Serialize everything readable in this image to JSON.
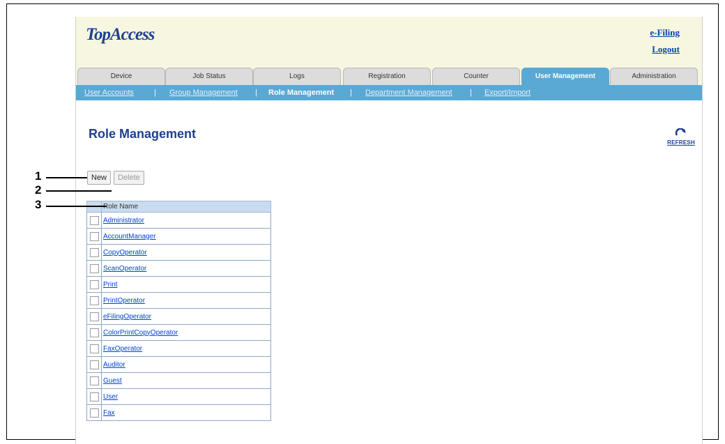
{
  "header": {
    "logo": "TopAccess",
    "links": {
      "efiling": "e-Filing",
      "logout": "Logout"
    }
  },
  "tabs": [
    {
      "label": "Device"
    },
    {
      "label": "Job Status"
    },
    {
      "label": "Logs"
    },
    {
      "label": "Registration"
    },
    {
      "label": "Counter"
    },
    {
      "label": "User Management",
      "active": true
    },
    {
      "label": "Administration"
    }
  ],
  "subnav": {
    "items": [
      "User Accounts",
      "Group Management",
      "Role Management",
      "Department Management",
      "Export/Import"
    ],
    "separator": "|",
    "active": "Role Management"
  },
  "page": {
    "title": "Role Management",
    "refresh_label": "REFRESH"
  },
  "toolbar": {
    "new_label": "New",
    "delete_label": "Delete"
  },
  "table": {
    "column_header": "Role Name",
    "rows": [
      "Administrator",
      "AccountManager",
      "CopyOperator",
      "ScanOperator",
      "Print",
      "PrintOperator",
      "eFilingOperator",
      "ColorPrintCopyOperator",
      "FaxOperator",
      "Auditor",
      "Guest",
      "User",
      "Fax"
    ]
  },
  "callouts": [
    "1",
    "2",
    "3"
  ],
  "colors": {
    "brand": "#1f3f8f",
    "tab_active": "#5aa8d4",
    "header_bg": "#f7f7e1",
    "link": "#0044cc"
  }
}
